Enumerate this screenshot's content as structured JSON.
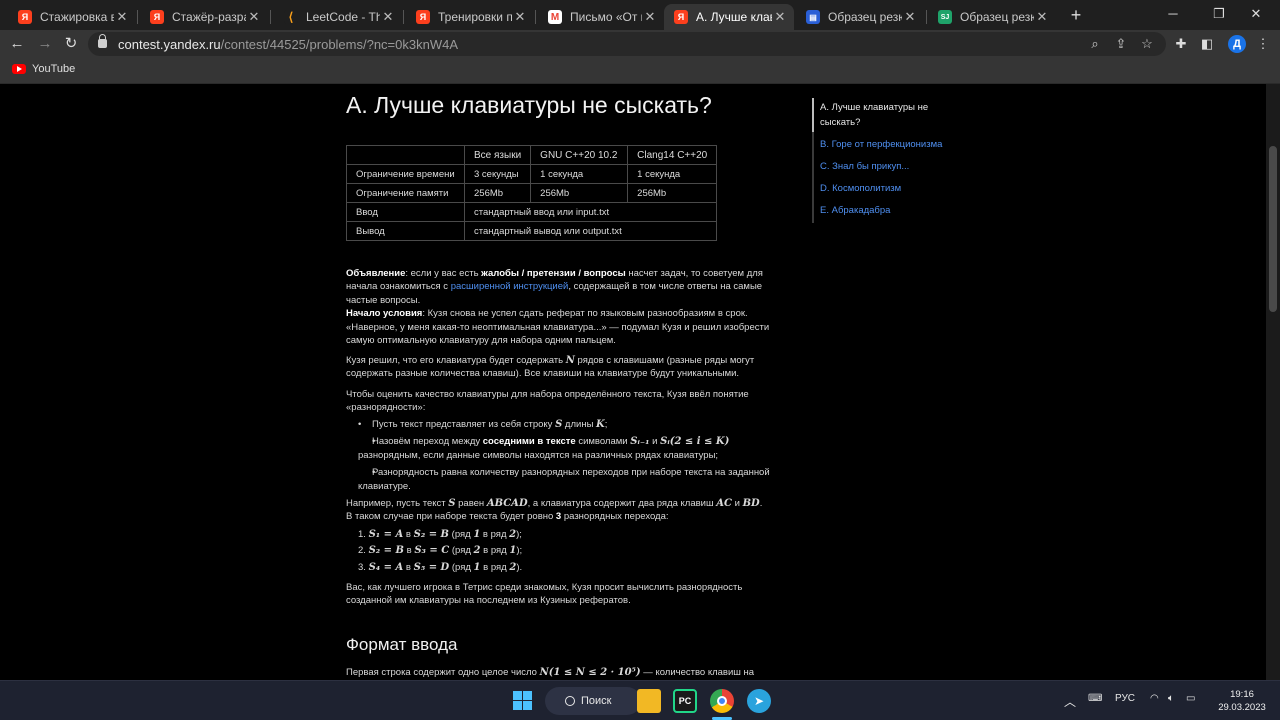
{
  "browser": {
    "tabs": [
      {
        "title": "Стажировка в Ян…",
        "favicon": "yandex-icon",
        "active": false
      },
      {
        "title": "Стажёр-разрабо…",
        "favicon": "yandex-icon",
        "active": false
      },
      {
        "title": "LeetCode - The W…",
        "favicon": "leetcode-icon",
        "active": false
      },
      {
        "title": "Тренировки по а…",
        "favicon": "yandex-icon",
        "active": false
      },
      {
        "title": "Письмо «От ком…",
        "favicon": "gmail-icon",
        "active": false
      },
      {
        "title": "А. Лучше клавиа…",
        "favicon": "yandex-icon",
        "active": true
      },
      {
        "title": "Образец резюме…",
        "favicon": "doc-icon",
        "active": false
      },
      {
        "title": "Образец резюме…",
        "favicon": "sj-icon",
        "active": false
      }
    ],
    "url_host": "contest.yandex.ru",
    "url_path": "/contest/44525/problems/?nc=0k3knW4A",
    "bookmark_youtube": "YouTube",
    "profile_initial": "Д"
  },
  "problem": {
    "title": "А. Лучше клавиатуры не сыскать?",
    "limits": {
      "headers": [
        "",
        "Все языки",
        "GNU C++20 10.2",
        "Clang14 C++20"
      ],
      "rows": [
        [
          "Ограничение времени",
          "3 секунды",
          "1 секунда",
          "1 секунда"
        ],
        [
          "Ограничение памяти",
          "256Mb",
          "256Mb",
          "256Mb"
        ],
        [
          "Ввод",
          "стандартный ввод или input.txt"
        ],
        [
          "Вывод",
          "стандартный вывод или output.txt"
        ]
      ]
    },
    "announce": {
      "label": "Объявление",
      "t1": ": если у вас есть ",
      "bold1": "жалобы / претензии / вопросы",
      "t2": " насчет задач, то советуем для начала ознакомиться с ",
      "link": "расширенной инструкцией",
      "t3": ", содержащей в том числе ответы на самые частые вопросы."
    },
    "start": {
      "label": "Начало условия",
      "text": ": Кузя снова не успел сдать реферат по языковым разнообразиям в срок. «Наверное, у меня какая-то неоптимальная клавиатура...» — подумал Кузя и решил изобрести самую оптимальную клавиатуру для набора одним пальцем."
    },
    "p2": {
      "t1": "Кузя решил, что его клавиатура будет содержать ",
      "m1": "N",
      "t2": " рядов с клавишами (разные ряды могут содержать разные количества клавиш). Все клавиши на клавиатуре будут уникальными."
    },
    "p3": "Чтобы оценить качество клавиатуры для набора определённого текста, Кузя ввёл понятие «разнорядности»:",
    "bullets": {
      "b1_t1": "Пусть текст представляет из себя строку ",
      "b1_m1": "S",
      "b1_t2": " длины ",
      "b1_m2": "K",
      "b1_t3": ";",
      "b2_t1": "Назовём переход между ",
      "b2_bold": "соседними в тексте",
      "b2_t2": " символами ",
      "b2_m1": "Sᵢ₋₁",
      "b2_t3": " и ",
      "b2_m2": "Sᵢ(2 ≤ i ≤ K)",
      "b2_t4": " разнорядным, если данные символы находятся на различных рядах клавиатуры;",
      "b3": "Разнорядность равна количеству разнорядных переходов при наборе текста на заданной клавиатуре."
    },
    "p4": {
      "t1": "Например, пусть текст ",
      "m1": "S",
      "t2": " равен ",
      "m2": "ABCAD",
      "t3": ", а клавиатура содержит два ряда клавиш ",
      "m3": "AC",
      "t4": " и ",
      "m4": "BD",
      "t5": ". В таком случае при наборе текста будет ровно ",
      "bold": "3",
      "t6": " разнорядных перехода:"
    },
    "ol": [
      {
        "n": "1.",
        "a": "S₁ = A",
        "t1": " в ",
        "b": "S₂ = B",
        "t2": " (ряд ",
        "r1": "1",
        "t3": " в ряд ",
        "r2": "2",
        "t4": ");"
      },
      {
        "n": "2.",
        "a": "S₂ = B",
        "t1": " в ",
        "b": "S₃ = C",
        "t2": " (ряд ",
        "r1": "2",
        "t3": " в ряд ",
        "r2": "1",
        "t4": ");"
      },
      {
        "n": "3.",
        "a": "S₄ = A",
        "t1": " в ",
        "b": "S₅ = D",
        "t2": " (ряд ",
        "r1": "1",
        "t3": " в ряд ",
        "r2": "2",
        "t4": ")."
      }
    ],
    "p5": "Вас, как лучшего игрока в Тетрис среди знакомых, Кузя просит вычислить разнорядность созданной им клавиатуры на последнем из Кузиных рефератов.",
    "input_format_title": "Формат ввода",
    "p6": {
      "t1": "Первая строка содержит одно целое число ",
      "m1": "N(1 ≤ N ≤ 2 · 10⁵)",
      "t2": " — количество клавиш на"
    }
  },
  "problem_nav": [
    {
      "label": "А. Лучше клавиатуры не сыскать?",
      "active": true
    },
    {
      "label": "B. Горе от перфекционизма",
      "active": false
    },
    {
      "label": "C. Знал бы прикуп...",
      "active": false
    },
    {
      "label": "D. Космополитизм",
      "active": false
    },
    {
      "label": "E. Абракадабра",
      "active": false
    }
  ],
  "taskbar": {
    "search_label": "Поиск",
    "lang": "РУС",
    "time": "19:16",
    "date": "29.03.2023"
  },
  "colors": {
    "link": "#4f8ff0",
    "yandex_red": "#fc3f1d",
    "windows_accent": "#4cc2ff"
  }
}
